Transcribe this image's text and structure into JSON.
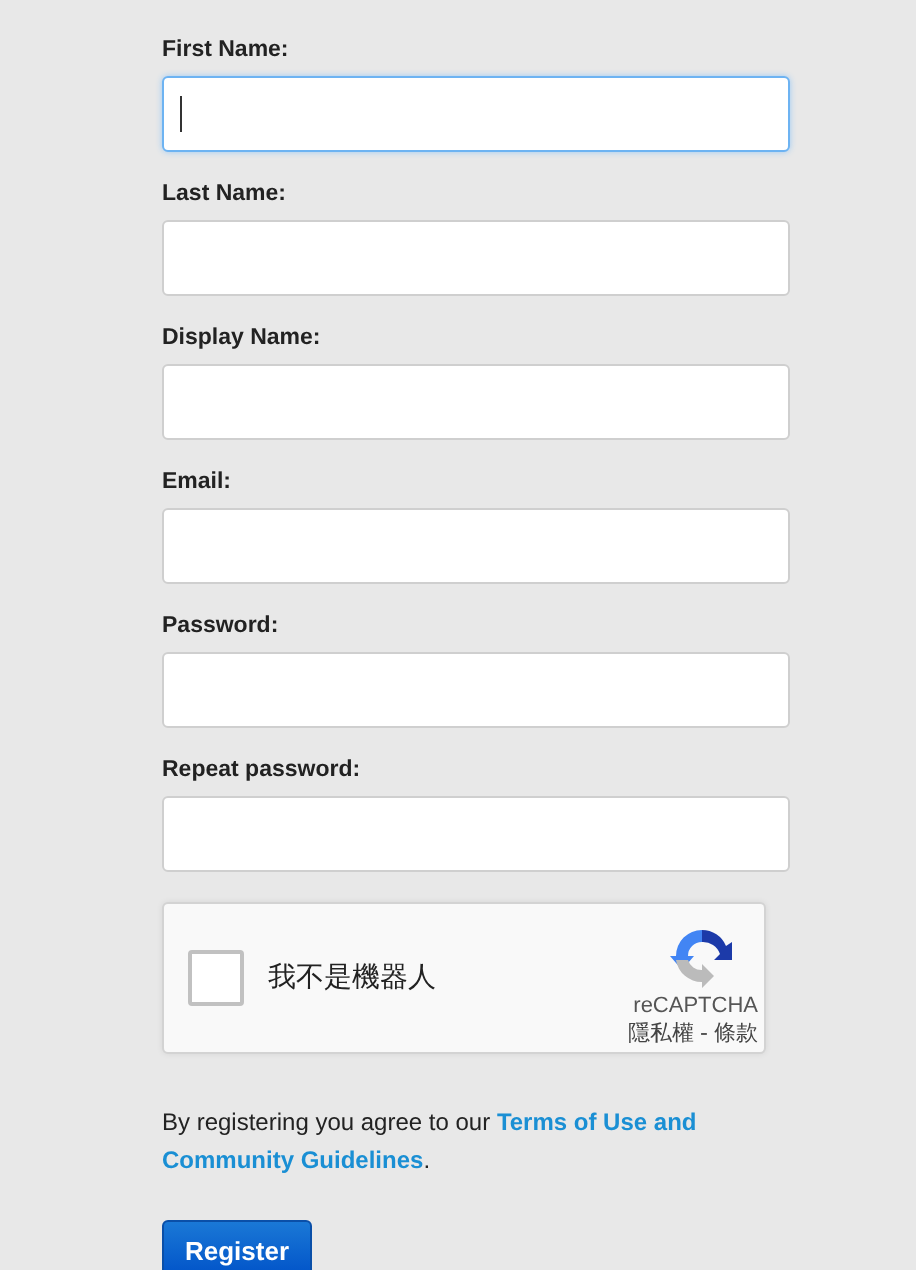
{
  "fields": [
    {
      "label": "First Name:",
      "focused": true
    },
    {
      "label": "Last Name:",
      "focused": false
    },
    {
      "label": "Display Name:",
      "focused": false
    },
    {
      "label": "Email:",
      "focused": false
    },
    {
      "label": "Password:",
      "focused": false
    },
    {
      "label": "Repeat password:",
      "focused": false
    }
  ],
  "captcha": {
    "checked": false,
    "label": "我不是機器人",
    "brand": "reCAPTCHA",
    "privacy_link": "隱私權",
    "separator": "-",
    "terms_link": "條款"
  },
  "agreement": {
    "text": "By registering you agree to our ",
    "links": [
      "Terms of Use and",
      "Community Guidelines"
    ],
    "end": "."
  },
  "submit": "Register"
}
